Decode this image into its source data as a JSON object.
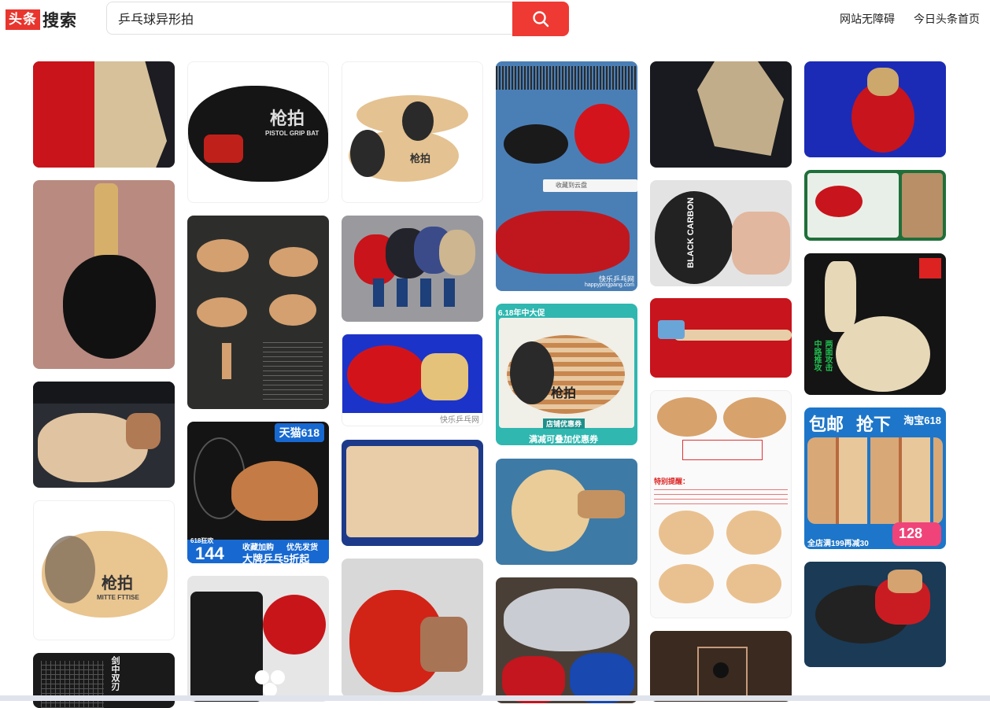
{
  "header": {
    "logo_box": "头条",
    "logo_text": "搜索",
    "search_value": "乒乓球异形拍",
    "links": [
      "网站无障碍",
      "今日头条首页"
    ]
  },
  "overlays": {
    "pistol_grip_cn": "枪拍",
    "pistol_grip_en": "PISTOL GRIP BAT",
    "tmall": "天猫618",
    "price_label": "618狂欢",
    "price": "144",
    "promo_line1": "收藏加购",
    "promo_line2": "优先发货",
    "promo_banner": "大牌乒乓5折起",
    "sale_618": "6.18年中大促",
    "shop_coupon": "店铺优惠券",
    "coupon_stack": "满减可叠加优惠券",
    "watermark_happy": "快乐乒乓网",
    "watermark_url": "happypingpang.com",
    "toolbar_save": "收藏到云盘",
    "black_carbon": "BLACK CARBON",
    "free_ship": "包邮",
    "grab": "抢下",
    "taobao": "淘宝618",
    "taobao_price": "128",
    "store_note": "全店满199再减30",
    "vertical_note": "中路推攻",
    "vertical_note2": "两面攻击",
    "sword_label": "剑中双刃",
    "warning_title": "特别提醒：",
    "ritti": "MITTE FTTISE"
  }
}
